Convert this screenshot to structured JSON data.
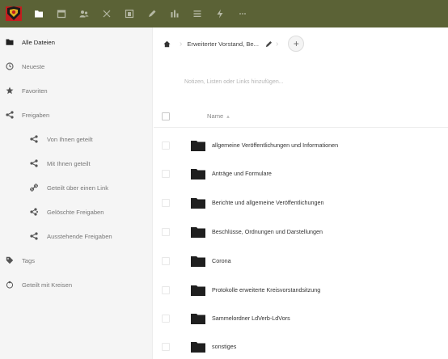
{
  "topbar": {
    "background": "#5b6236",
    "app_icons": [
      "files-icon",
      "calendar-icon",
      "contacts-icon",
      "crossed-tools-icon",
      "presentation-icon",
      "pencil-icon",
      "bar-chart-icon",
      "list-icon",
      "activity-icon",
      "more-icon"
    ]
  },
  "sidebar": {
    "items": [
      {
        "label": "Alle Dateien",
        "icon": "folder-icon"
      },
      {
        "label": "Neueste",
        "icon": "clock-icon"
      },
      {
        "label": "Favoriten",
        "icon": "star-icon"
      },
      {
        "label": "Freigaben",
        "icon": "share-icon"
      },
      {
        "label": "Von Ihnen geteilt",
        "icon": "share-icon"
      },
      {
        "label": "Mit Ihnen geteilt",
        "icon": "share-icon"
      },
      {
        "label": "Geteilt über einen Link",
        "icon": "link-icon"
      },
      {
        "label": "Gelöschte Freigaben",
        "icon": "share-deleted-icon"
      },
      {
        "label": "Ausstehende Freigaben",
        "icon": "share-icon"
      },
      {
        "label": "Tags",
        "icon": "tag-icon"
      },
      {
        "label": "Geteilt mit Kreisen",
        "icon": "circles-icon"
      }
    ]
  },
  "main": {
    "breadcrumb": "Erweiterter Vorstand, Be...",
    "add_label": "+",
    "notes_placeholder": "Notizen, Listen oder Links hinzufügen...",
    "name_header": "Name",
    "sort_indicator": "▴",
    "files": [
      "allgemeine Veröffentlichungen und Informationen",
      "Anträge und Formulare",
      "Berichte und allgemeine Veröffentlichungen",
      "Beschlüsse, Ordnungen und Darstellungen",
      "Corona",
      "Protokolle erweiterte Kreisvorstandsitzung",
      "Sammelordner LdVerb-LdVors",
      "sonstiges"
    ]
  }
}
